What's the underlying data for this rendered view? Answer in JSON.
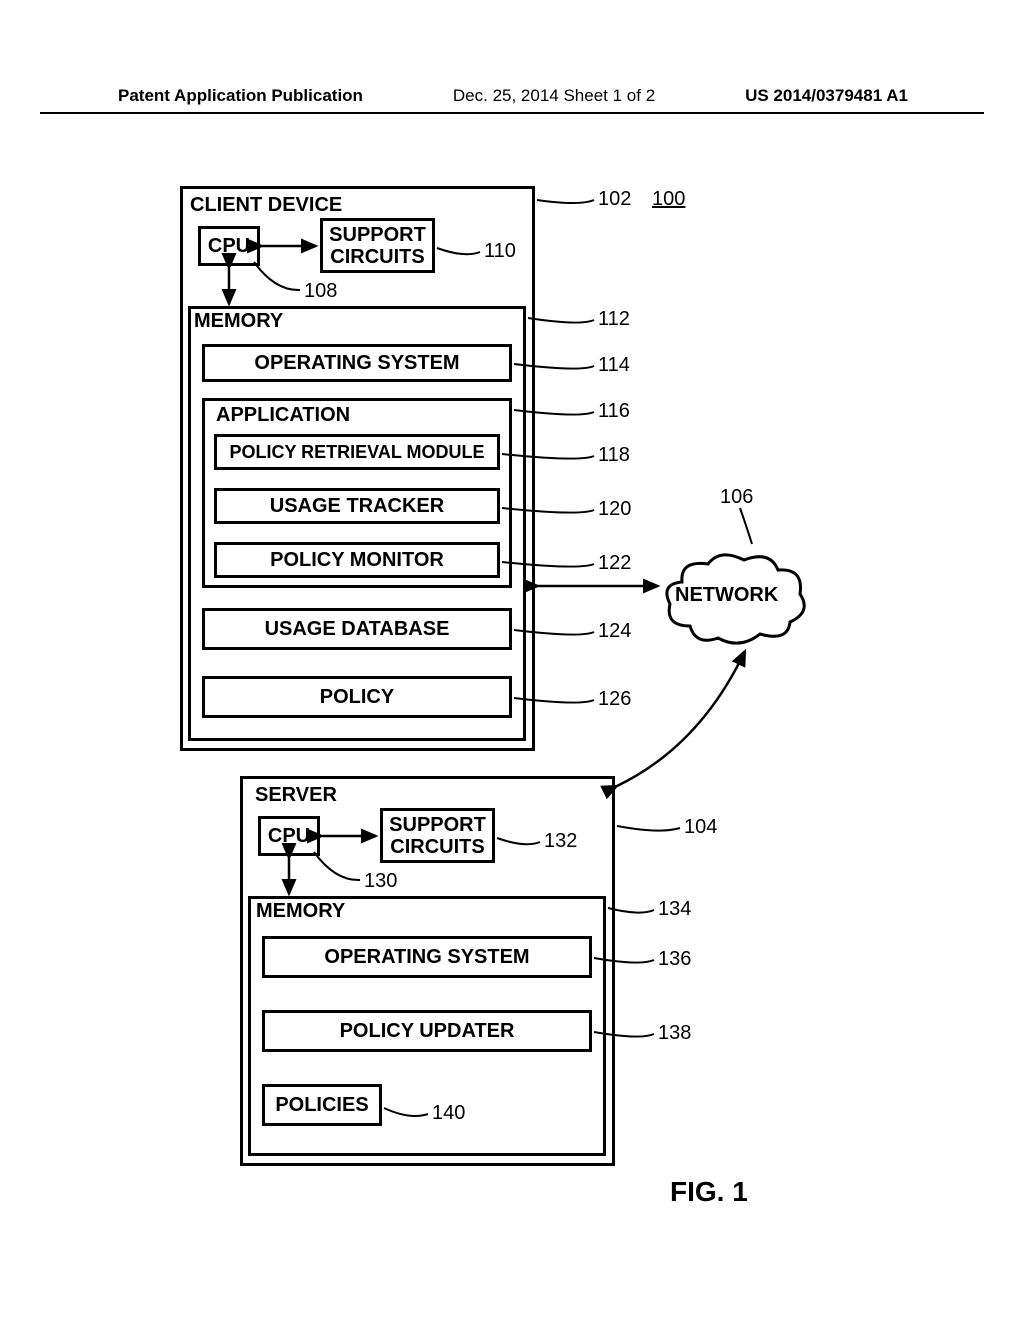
{
  "header": {
    "left": "Patent Application Publication",
    "center": "Dec. 25, 2014  Sheet 1 of 2",
    "right": "US 2014/0379481 A1"
  },
  "client": {
    "title": "CLIENT DEVICE",
    "cpu": "CPU",
    "support": {
      "l1": "SUPPORT",
      "l2": "CIRCUITS"
    },
    "memory": "MEMORY",
    "os": "OPERATING SYSTEM",
    "app": "APPLICATION",
    "prm": "POLICY RETRIEVAL MODULE",
    "ut": "USAGE TRACKER",
    "pm": "POLICY MONITOR",
    "udb": "USAGE DATABASE",
    "pol": "POLICY"
  },
  "server": {
    "title": "SERVER",
    "cpu": "CPU",
    "support": {
      "l1": "SUPPORT",
      "l2": "CIRCUITS"
    },
    "memory": "MEMORY",
    "os": "OPERATING SYSTEM",
    "pu": "POLICY UPDATER",
    "pols": "POLICIES"
  },
  "network": "NETWORK",
  "refs": {
    "r100": "100",
    "r102": "102",
    "r104": "104",
    "r106": "106",
    "r108": "108",
    "r110": "110",
    "r112": "112",
    "r114": "114",
    "r116": "116",
    "r118": "118",
    "r120": "120",
    "r122": "122",
    "r124": "124",
    "r126": "126",
    "r130": "130",
    "r132": "132",
    "r134": "134",
    "r136": "136",
    "r138": "138",
    "r140": "140"
  },
  "figure": "FIG. 1"
}
